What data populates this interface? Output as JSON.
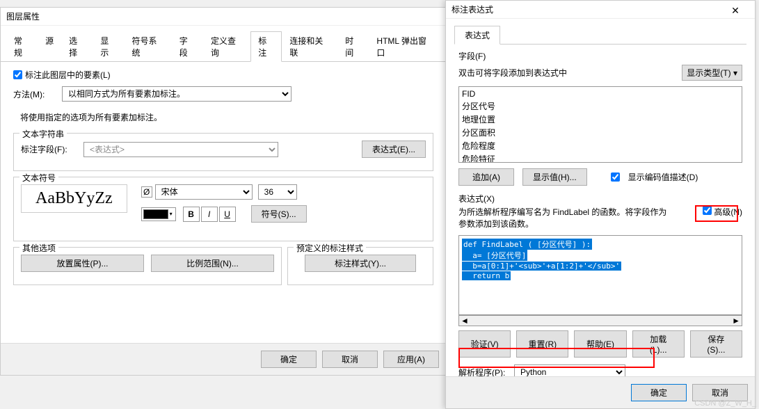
{
  "leftWindow": {
    "title": "图层属性",
    "tabs": [
      "常规",
      "源",
      "选择",
      "显示",
      "符号系统",
      "字段",
      "定义查询",
      "标注",
      "连接和关联",
      "时间",
      "HTML 弹出窗口"
    ],
    "activeTab": "标注",
    "checkbox1": "标注此图层中的要素(L)",
    "methodLabel": "方法(M):",
    "methodValue": "以相同方式为所有要素加标注。",
    "hint": "将使用指定的选项为所有要素加标注。",
    "group1": {
      "title": "文本字符串",
      "fieldLabel": "标注字段(F):",
      "fieldValue": "<表达式>",
      "exprBtn": "表达式(E)..."
    },
    "group2": {
      "title": "文本符号",
      "preview": "AaBbYyZz",
      "font": "宋体",
      "size": "36",
      "bold": "B",
      "italic": "I",
      "underline": "U",
      "symbolBtn": "符号(S)..."
    },
    "group3": {
      "title": "其他选项",
      "btn1": "放置属性(P)...",
      "btn2": "比例范围(N)..."
    },
    "group4": {
      "title": "预定义的标注样式",
      "btn1": "标注样式(Y)..."
    },
    "footer": {
      "ok": "确定",
      "cancel": "取消",
      "apply": "应用(A)"
    }
  },
  "rightWindow": {
    "title": "标注表达式",
    "tabLabel": "表达式",
    "fieldsLabel": "字段(F)",
    "fieldsHint": "双击可将字段添加到表达式中",
    "showTypeBtn": "显示类型(T)",
    "fields": [
      "FID",
      "分区代号",
      "地理位置",
      "分区面积",
      "危险程度",
      "危险特征"
    ],
    "addBtn": "追加(A)",
    "showValBtn": "显示值(H)...",
    "showCodeCheck": "显示编码值描述(D)",
    "exprLabel": "表达式(X)",
    "exprHint": "为所选解析程序编写名为 FindLabel 的函数。将字段作为参数添加到该函数。",
    "advancedCheck": "高级(N)",
    "code": {
      "line1": "def FindLabel ( [分区代号] ):",
      "line2": "  a= [分区代号]",
      "line3": "  b=a[0:1]+'<sub>'+a[1:2]+'</sub>'",
      "line4": "  return b"
    },
    "btnRow": {
      "verify": "验证(V)",
      "reset": "重置(R)",
      "help": "帮助(E)",
      "load": "加载(L)...",
      "save": "保存(S)..."
    },
    "parserLabel": "解析程序(P):",
    "parserValue": "Python",
    "footer": {
      "ok": "确定",
      "cancel": "取消"
    }
  },
  "watermark": "CSDN @Z_W_H_"
}
